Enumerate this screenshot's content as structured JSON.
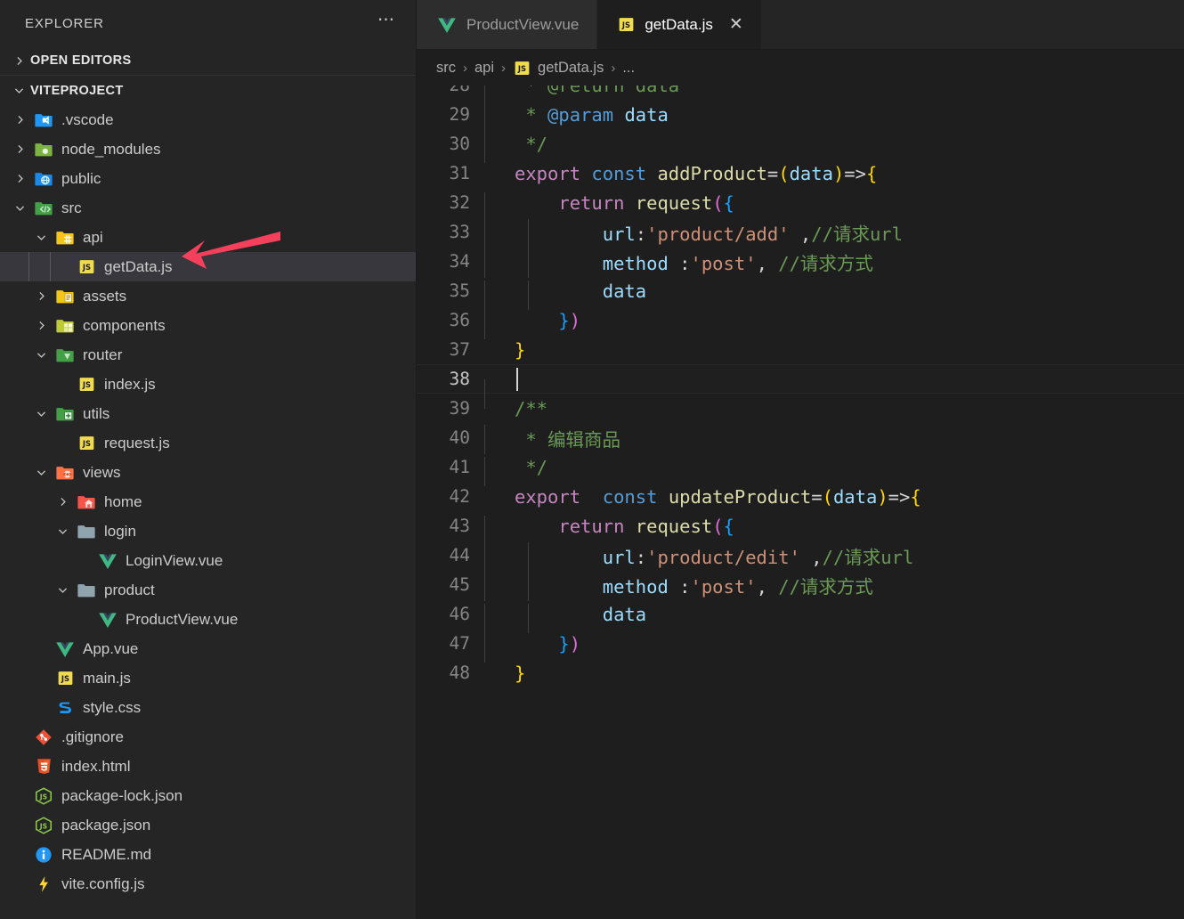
{
  "sidebar": {
    "header_title": "EXPLORER",
    "more_icon": "ellipsis-icon",
    "sections": [
      {
        "label": "OPEN EDITORS",
        "expanded": false
      },
      {
        "label": "VITEPROJECT",
        "expanded": true
      }
    ],
    "tree": [
      {
        "label": ".vscode",
        "depth": 1,
        "type": "folder",
        "icon": "vscode-folder-icon",
        "chev": "right",
        "selected": false
      },
      {
        "label": "node_modules",
        "depth": 1,
        "type": "folder",
        "icon": "node-folder-icon",
        "chev": "right",
        "selected": false
      },
      {
        "label": "public",
        "depth": 1,
        "type": "folder",
        "icon": "public-folder-icon",
        "chev": "right",
        "selected": false
      },
      {
        "label": "src",
        "depth": 1,
        "type": "folder",
        "icon": "src-folder-icon",
        "chev": "down",
        "selected": false
      },
      {
        "label": "api",
        "depth": 2,
        "type": "folder",
        "icon": "api-folder-icon",
        "chev": "down",
        "selected": false
      },
      {
        "label": "getData.js",
        "depth": 3,
        "type": "file",
        "icon": "js-file-icon",
        "chev": "none",
        "selected": true
      },
      {
        "label": "assets",
        "depth": 2,
        "type": "folder",
        "icon": "assets-folder-icon",
        "chev": "right",
        "selected": false
      },
      {
        "label": "components",
        "depth": 2,
        "type": "folder",
        "icon": "components-folder-icon",
        "chev": "right",
        "selected": false
      },
      {
        "label": "router",
        "depth": 2,
        "type": "folder",
        "icon": "router-folder-icon",
        "chev": "down",
        "selected": false
      },
      {
        "label": "index.js",
        "depth": 3,
        "type": "file",
        "icon": "js-file-icon",
        "chev": "none",
        "selected": false
      },
      {
        "label": "utils",
        "depth": 2,
        "type": "folder",
        "icon": "utils-folder-icon",
        "chev": "down",
        "selected": false
      },
      {
        "label": "request.js",
        "depth": 3,
        "type": "file",
        "icon": "js-file-icon",
        "chev": "none",
        "selected": false
      },
      {
        "label": "views",
        "depth": 2,
        "type": "folder",
        "icon": "views-folder-icon",
        "chev": "down",
        "selected": false
      },
      {
        "label": "home",
        "depth": 3,
        "type": "folder",
        "icon": "home-folder-icon",
        "chev": "right",
        "selected": false
      },
      {
        "label": "login",
        "depth": 3,
        "type": "folder",
        "icon": "plain-folder-icon",
        "chev": "down",
        "selected": false
      },
      {
        "label": "LoginView.vue",
        "depth": 4,
        "type": "file",
        "icon": "vue-file-icon",
        "chev": "none",
        "selected": false
      },
      {
        "label": "product",
        "depth": 3,
        "type": "folder",
        "icon": "plain-folder-icon",
        "chev": "down",
        "selected": false
      },
      {
        "label": "ProductView.vue",
        "depth": 4,
        "type": "file",
        "icon": "vue-file-icon",
        "chev": "none",
        "selected": false
      },
      {
        "label": "App.vue",
        "depth": 2,
        "type": "file",
        "icon": "vue-file-icon",
        "chev": "none",
        "selected": false
      },
      {
        "label": "main.js",
        "depth": 2,
        "type": "file",
        "icon": "js-file-icon",
        "chev": "none",
        "selected": false
      },
      {
        "label": "style.css",
        "depth": 2,
        "type": "file",
        "icon": "css-file-icon",
        "chev": "none",
        "selected": false
      },
      {
        "label": ".gitignore",
        "depth": 1,
        "type": "file",
        "icon": "git-file-icon",
        "chev": "none",
        "selected": false
      },
      {
        "label": "index.html",
        "depth": 1,
        "type": "file",
        "icon": "html-file-icon",
        "chev": "none",
        "selected": false
      },
      {
        "label": "package-lock.json",
        "depth": 1,
        "type": "file",
        "icon": "npm-file-icon",
        "chev": "none",
        "selected": false
      },
      {
        "label": "package.json",
        "depth": 1,
        "type": "file",
        "icon": "npm-file-icon",
        "chev": "none",
        "selected": false
      },
      {
        "label": "README.md",
        "depth": 1,
        "type": "file",
        "icon": "info-file-icon",
        "chev": "none",
        "selected": false
      },
      {
        "label": "vite.config.js",
        "depth": 1,
        "type": "file",
        "icon": "vite-file-icon",
        "chev": "none",
        "selected": false
      }
    ]
  },
  "tabs": [
    {
      "label": "ProductView.vue",
      "icon": "vue-file-icon",
      "active": false,
      "closable": false
    },
    {
      "label": "getData.js",
      "icon": "js-file-icon",
      "active": true,
      "closable": true
    }
  ],
  "breadcrumb": [
    {
      "label": "src",
      "icon": "none"
    },
    {
      "label": "api",
      "icon": "none"
    },
    {
      "label": "getData.js",
      "icon": "js-file-icon"
    },
    {
      "label": "...",
      "icon": "none"
    }
  ],
  "editor": {
    "active_line": 38,
    "first_visible_line": 28,
    "lines": [
      {
        "n": 28,
        "clipped": true,
        "tokens": [
          {
            "t": " * @return data",
            "c": "t-comment"
          }
        ]
      },
      {
        "n": 29,
        "tokens": [
          {
            "t": " * ",
            "c": "t-comment"
          },
          {
            "t": "@param",
            "c": "t-jsdoc"
          },
          {
            "t": " ",
            "c": "t-comment"
          },
          {
            "t": "data",
            "c": "t-var"
          }
        ]
      },
      {
        "n": 30,
        "tokens": [
          {
            "t": " */",
            "c": "t-comment"
          }
        ]
      },
      {
        "n": 31,
        "tokens": [
          {
            "t": "export",
            "c": "t-kw"
          },
          {
            "t": " ",
            "c": "t-plain"
          },
          {
            "t": "const",
            "c": "t-kw2"
          },
          {
            "t": " ",
            "c": "t-plain"
          },
          {
            "t": "addProduct",
            "c": "t-fn"
          },
          {
            "t": "=",
            "c": "t-plain"
          },
          {
            "t": "(",
            "c": "t-p1"
          },
          {
            "t": "data",
            "c": "t-var"
          },
          {
            "t": ")",
            "c": "t-p1"
          },
          {
            "t": "=>",
            "c": "t-plain"
          },
          {
            "t": "{",
            "c": "t-p1"
          }
        ]
      },
      {
        "n": 32,
        "tokens": [
          {
            "t": "    ",
            "c": "t-plain"
          },
          {
            "t": "return",
            "c": "t-kw"
          },
          {
            "t": " ",
            "c": "t-plain"
          },
          {
            "t": "request",
            "c": "t-fn"
          },
          {
            "t": "(",
            "c": "t-p2"
          },
          {
            "t": "{",
            "c": "t-p3"
          }
        ]
      },
      {
        "n": 33,
        "tokens": [
          {
            "t": "        ",
            "c": "t-plain"
          },
          {
            "t": "url",
            "c": "t-var"
          },
          {
            "t": ":",
            "c": "t-plain"
          },
          {
            "t": "'product/add'",
            "c": "t-str"
          },
          {
            "t": " ,",
            "c": "t-plain"
          },
          {
            "t": "//请求url",
            "c": "t-comment"
          }
        ]
      },
      {
        "n": 34,
        "tokens": [
          {
            "t": "        ",
            "c": "t-plain"
          },
          {
            "t": "method",
            "c": "t-var"
          },
          {
            "t": " :",
            "c": "t-plain"
          },
          {
            "t": "'post'",
            "c": "t-str"
          },
          {
            "t": ", ",
            "c": "t-plain"
          },
          {
            "t": "//请求方式",
            "c": "t-comment"
          }
        ]
      },
      {
        "n": 35,
        "tokens": [
          {
            "t": "        ",
            "c": "t-plain"
          },
          {
            "t": "data",
            "c": "t-var"
          }
        ]
      },
      {
        "n": 36,
        "tokens": [
          {
            "t": "    ",
            "c": "t-plain"
          },
          {
            "t": "}",
            "c": "t-p3"
          },
          {
            "t": ")",
            "c": "t-p2"
          }
        ]
      },
      {
        "n": 37,
        "tokens": [
          {
            "t": "}",
            "c": "t-p1"
          }
        ]
      },
      {
        "n": 38,
        "tokens": []
      },
      {
        "n": 39,
        "tokens": [
          {
            "t": "/**",
            "c": "t-comment"
          }
        ]
      },
      {
        "n": 40,
        "tokens": [
          {
            "t": " * 编辑商品",
            "c": "t-comment"
          }
        ]
      },
      {
        "n": 41,
        "tokens": [
          {
            "t": " */",
            "c": "t-comment"
          }
        ]
      },
      {
        "n": 42,
        "tokens": [
          {
            "t": "export",
            "c": "t-kw"
          },
          {
            "t": "  ",
            "c": "t-plain"
          },
          {
            "t": "const",
            "c": "t-kw2"
          },
          {
            "t": " ",
            "c": "t-plain"
          },
          {
            "t": "updateProduct",
            "c": "t-fn"
          },
          {
            "t": "=",
            "c": "t-plain"
          },
          {
            "t": "(",
            "c": "t-p1"
          },
          {
            "t": "data",
            "c": "t-var"
          },
          {
            "t": ")",
            "c": "t-p1"
          },
          {
            "t": "=>",
            "c": "t-plain"
          },
          {
            "t": "{",
            "c": "t-p1"
          }
        ]
      },
      {
        "n": 43,
        "tokens": [
          {
            "t": "    ",
            "c": "t-plain"
          },
          {
            "t": "return",
            "c": "t-kw"
          },
          {
            "t": " ",
            "c": "t-plain"
          },
          {
            "t": "request",
            "c": "t-fn"
          },
          {
            "t": "(",
            "c": "t-p2"
          },
          {
            "t": "{",
            "c": "t-p3"
          }
        ]
      },
      {
        "n": 44,
        "tokens": [
          {
            "t": "        ",
            "c": "t-plain"
          },
          {
            "t": "url",
            "c": "t-var"
          },
          {
            "t": ":",
            "c": "t-plain"
          },
          {
            "t": "'product/edit'",
            "c": "t-str"
          },
          {
            "t": " ,",
            "c": "t-plain"
          },
          {
            "t": "//请求url",
            "c": "t-comment"
          }
        ]
      },
      {
        "n": 45,
        "tokens": [
          {
            "t": "        ",
            "c": "t-plain"
          },
          {
            "t": "method",
            "c": "t-var"
          },
          {
            "t": " :",
            "c": "t-plain"
          },
          {
            "t": "'post'",
            "c": "t-str"
          },
          {
            "t": ", ",
            "c": "t-plain"
          },
          {
            "t": "//请求方式",
            "c": "t-comment"
          }
        ]
      },
      {
        "n": 46,
        "tokens": [
          {
            "t": "        ",
            "c": "t-plain"
          },
          {
            "t": "data",
            "c": "t-var"
          }
        ]
      },
      {
        "n": 47,
        "tokens": [
          {
            "t": "    ",
            "c": "t-plain"
          },
          {
            "t": "}",
            "c": "t-p3"
          },
          {
            "t": ")",
            "c": "t-p2"
          }
        ]
      },
      {
        "n": 48,
        "tokens": [
          {
            "t": "}",
            "c": "t-p1"
          }
        ]
      }
    ]
  },
  "annotation": {
    "type": "red-arrow",
    "color": "#f4405a",
    "points_to": "getData.js",
    "direction": "left"
  },
  "colors": {
    "sidebar_bg": "#252526",
    "editor_bg": "#1e1e1e",
    "tab_inactive_bg": "#2d2d2d",
    "selected_row_bg": "#37373d",
    "accent_red": "#f4405a"
  }
}
